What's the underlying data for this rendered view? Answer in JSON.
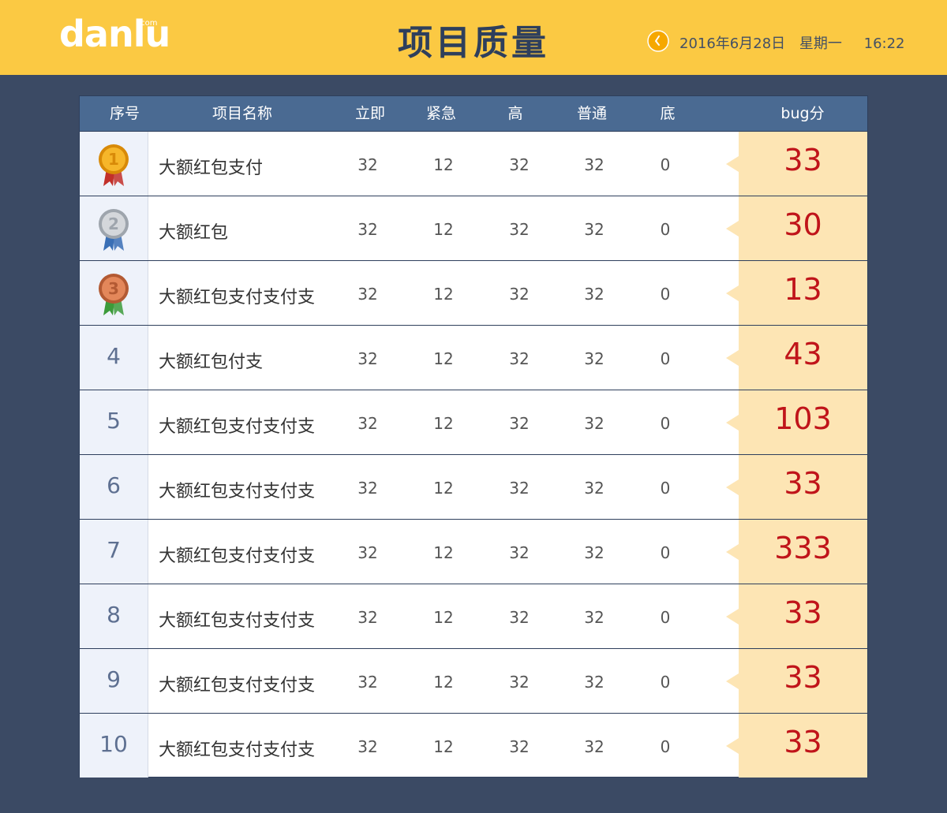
{
  "header": {
    "logo": "danlu",
    "logo_suffix": ".com",
    "title": "项目质量",
    "date": "2016年6月28日",
    "weekday": "星期一",
    "time": "16:22"
  },
  "table": {
    "columns": [
      "序号",
      "项目名称",
      "立即",
      "紧急",
      "高",
      "普通",
      "底",
      "bug分"
    ],
    "rows": [
      {
        "rank": "1",
        "medal": "gold-medal-icon",
        "name": "大额红包支付",
        "lijí": "32",
        "jinji": "12",
        "gao": "32",
        "putong": "32",
        "di": "0",
        "score": "33"
      },
      {
        "rank": "2",
        "medal": "silver-medal-icon",
        "name": "大额红包",
        "lijí": "32",
        "jinji": "12",
        "gao": "32",
        "putong": "32",
        "di": "0",
        "score": "30"
      },
      {
        "rank": "3",
        "medal": "bronze-medal-icon",
        "name": "大额红包支付支付支",
        "lijí": "32",
        "jinji": "12",
        "gao": "32",
        "putong": "32",
        "di": "0",
        "score": "13"
      },
      {
        "rank": "4",
        "name": "大额红包付支",
        "lijí": "32",
        "jinji": "12",
        "gao": "32",
        "putong": "32",
        "di": "0",
        "score": "43"
      },
      {
        "rank": "5",
        "name": "大额红包支付支付支",
        "lijí": "32",
        "jinji": "12",
        "gao": "32",
        "putong": "32",
        "di": "0",
        "score": "103"
      },
      {
        "rank": "6",
        "name": "大额红包支付支付支",
        "lijí": "32",
        "jinji": "12",
        "gao": "32",
        "putong": "32",
        "di": "0",
        "score": "33"
      },
      {
        "rank": "7",
        "name": "大额红包支付支付支",
        "lijí": "32",
        "jinji": "12",
        "gao": "32",
        "putong": "32",
        "di": "0",
        "score": "333"
      },
      {
        "rank": "8",
        "name": "大额红包支付支付支",
        "lijí": "32",
        "jinji": "12",
        "gao": "32",
        "putong": "32",
        "di": "0",
        "score": "33"
      },
      {
        "rank": "9",
        "name": "大额红包支付支付支",
        "lijí": "32",
        "jinji": "12",
        "gao": "32",
        "putong": "32",
        "di": "0",
        "score": "33"
      },
      {
        "rank": "10",
        "name": "大额红包支付支付支",
        "lijí": "32",
        "jinji": "12",
        "gao": "32",
        "putong": "32",
        "di": "0",
        "score": "33"
      }
    ]
  },
  "colors": {
    "header_bg": "#fbc943",
    "page_bg": "#3b4a64",
    "table_header_bg": "#4a6a92",
    "score_bg": "#fde5b4",
    "score_text": "#c0141a"
  }
}
